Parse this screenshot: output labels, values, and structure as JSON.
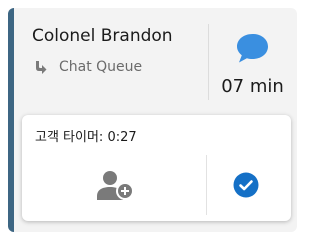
{
  "contact": {
    "name": "Colonel Brandon",
    "queue_icon": "arrow-down-right-icon",
    "queue_label": "Chat Queue"
  },
  "status": {
    "channel_icon": "chat-bubble-icon",
    "wait_time": "07 min"
  },
  "timer_panel": {
    "timer_text": "고객 타이머: 0:27",
    "add_participant_icon": "add-user-icon",
    "accept_icon": "check-circle-icon"
  },
  "colors": {
    "accent_bar": "#3d6683",
    "chat_icon": "#3a8fe0",
    "check_button": "#1570c6",
    "icon_gray": "#7a7a7a"
  }
}
